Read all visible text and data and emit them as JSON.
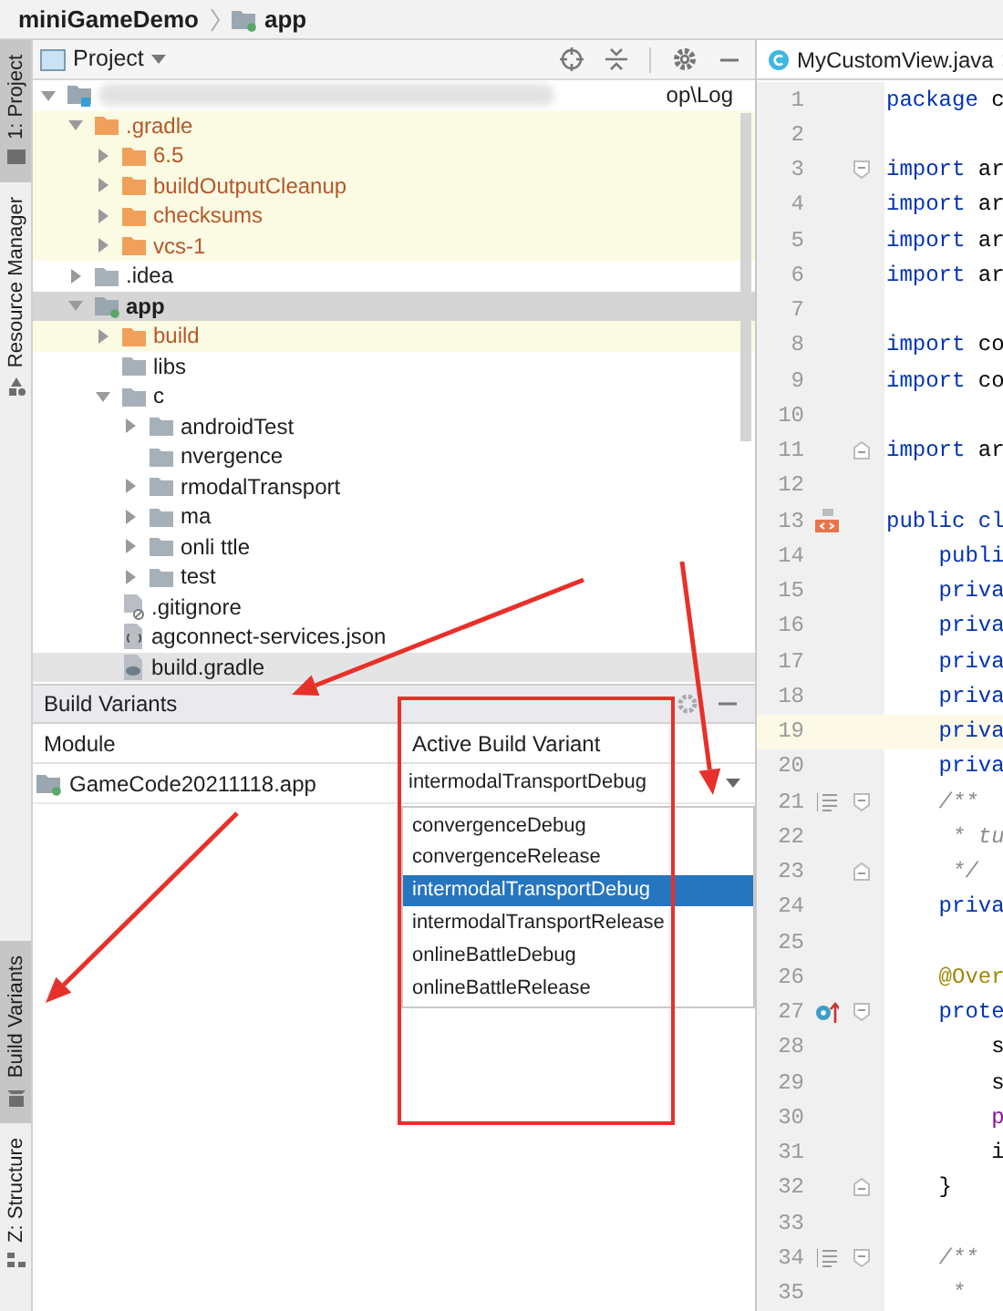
{
  "breadcrumb": [
    {
      "label": "miniGameDemo",
      "kind": "project"
    },
    {
      "label": "app",
      "kind": "module"
    }
  ],
  "tool_strip": {
    "top": [
      {
        "label": "1: Project",
        "kind": "folder",
        "selected": true
      },
      {
        "label": "Resource Manager",
        "kind": "resources",
        "selected": false
      }
    ],
    "bottom": [
      {
        "label": "Build Variants",
        "kind": "android",
        "selected": true
      },
      {
        "label": "Z: Structure",
        "kind": "structure",
        "selected": false
      }
    ]
  },
  "project_panel": {
    "title": "Project",
    "tree": [
      {
        "kind": "module-root",
        "label": "op\\Log",
        "expanded": true,
        "excluded": false,
        "selected": false,
        "children": [
          {
            "kind": "folder",
            "label": ".gradle",
            "expanded": true,
            "excluded": true,
            "selected": false,
            "children": [
              {
                "kind": "folder",
                "label": "6.5",
                "expanded": false,
                "excluded": true,
                "selected": false
              },
              {
                "kind": "folder",
                "label": "buildOutputCleanup",
                "expanded": false,
                "excluded": true,
                "selected": false
              },
              {
                "kind": "folder",
                "label": "checksums",
                "expanded": false,
                "excluded": true,
                "selected": false
              },
              {
                "kind": "folder",
                "label": "vcs-1",
                "expanded": false,
                "excluded": true,
                "selected": false
              }
            ]
          },
          {
            "kind": "folder",
            "label": ".idea",
            "expanded": false,
            "excluded": false,
            "selected": false
          },
          {
            "kind": "module",
            "label": "app",
            "expanded": true,
            "excluded": false,
            "selected": true,
            "children": [
              {
                "kind": "folder",
                "label": "build",
                "expanded": false,
                "excluded": true,
                "selected": false
              },
              {
                "kind": "folder",
                "label": "libs",
                "excluded": false,
                "selected": false
              },
              {
                "kind": "folder",
                "label": "c",
                "expanded": true,
                "excluded": false,
                "selected": false,
                "children": [
                  {
                    "kind": "folder",
                    "label": "androidTest",
                    "expanded": false,
                    "excluded": false,
                    "selected": false
                  },
                  {
                    "kind": "folder",
                    "label": "nvergence",
                    "excluded": false,
                    "selected": false
                  },
                  {
                    "kind": "folder",
                    "label": "rmodalTransport",
                    "expanded": false,
                    "excluded": false,
                    "selected": false
                  },
                  {
                    "kind": "folder",
                    "label": "ma",
                    "expanded": false,
                    "excluded": false,
                    "selected": false
                  },
                  {
                    "kind": "folder",
                    "label": "onli ttle",
                    "expanded": false,
                    "excluded": false,
                    "selected": false
                  },
                  {
                    "kind": "folder",
                    "label": "test",
                    "expanded": false,
                    "excluded": false,
                    "selected": false
                  }
                ]
              },
              {
                "kind": "file-ignore",
                "label": ".gitignore",
                "excluded": false,
                "selected": false
              },
              {
                "kind": "file-json",
                "label": "agconnect-services.json",
                "excluded": false,
                "selected": false
              },
              {
                "kind": "file-gradle",
                "label": "build.gradle",
                "excluded": false,
                "selected": true
              }
            ]
          }
        ]
      }
    ]
  },
  "build_variants": {
    "title": "Build Variants",
    "columns": [
      "Module",
      "Active Build Variant"
    ],
    "rows": [
      {
        "module": "GameCode20211118.app",
        "variant": "intermodalTransportDebug"
      }
    ],
    "options": [
      {
        "label": "convergenceDebug",
        "selected": false
      },
      {
        "label": "convergenceRelease",
        "selected": false
      },
      {
        "label": "intermodalTransportDebug",
        "selected": true
      },
      {
        "label": "intermodalTransportRelease",
        "selected": false
      },
      {
        "label": "onlineBattleDebug",
        "selected": false
      },
      {
        "label": "onlineBattleRelease",
        "selected": false
      }
    ]
  },
  "editor": {
    "tabs": [
      {
        "label": "MyCustomView.java",
        "selected": true
      }
    ],
    "lines": [
      {
        "number": "1",
        "current": false,
        "tokens": [
          {
            "text": "package",
            "kind": "keyword"
          },
          {
            "text": " c",
            "kind": "plain"
          }
        ]
      },
      {
        "number": "2",
        "current": false
      },
      {
        "number": "3",
        "current": false,
        "fold_start": true,
        "tokens": [
          {
            "text": "import",
            "kind": "keyword"
          },
          {
            "text": " ar",
            "kind": "plain"
          }
        ]
      },
      {
        "number": "4",
        "current": false,
        "tokens": [
          {
            "text": "import",
            "kind": "keyword"
          },
          {
            "text": " ar",
            "kind": "plain"
          }
        ]
      },
      {
        "number": "5",
        "current": false,
        "tokens": [
          {
            "text": "import",
            "kind": "keyword"
          },
          {
            "text": " ar",
            "kind": "plain"
          }
        ]
      },
      {
        "number": "6",
        "current": false,
        "tokens": [
          {
            "text": "import",
            "kind": "keyword"
          },
          {
            "text": " ar",
            "kind": "plain"
          }
        ]
      },
      {
        "number": "7",
        "current": false
      },
      {
        "number": "8",
        "current": false,
        "tokens": [
          {
            "text": "import",
            "kind": "keyword"
          },
          {
            "text": " co",
            "kind": "plain"
          }
        ]
      },
      {
        "number": "9",
        "current": false,
        "tokens": [
          {
            "text": "import",
            "kind": "keyword"
          },
          {
            "text": " co",
            "kind": "plain"
          }
        ]
      },
      {
        "number": "10",
        "current": false
      },
      {
        "number": "11",
        "current": false,
        "fold_end": true,
        "tokens": [
          {
            "text": "import",
            "kind": "keyword"
          },
          {
            "text": " ar",
            "kind": "plain"
          }
        ]
      },
      {
        "number": "12",
        "current": false
      },
      {
        "number": "13",
        "current": false,
        "class_marker": true,
        "tokens": [
          {
            "text": "public",
            "kind": "keyword"
          },
          {
            "text": " cl",
            "kind": "keyword"
          }
        ]
      },
      {
        "number": "14",
        "current": false,
        "tokens": [
          {
            "text": "    publi",
            "kind": "keyword"
          }
        ]
      },
      {
        "number": "15",
        "current": false,
        "tokens": [
          {
            "text": "    priva",
            "kind": "keyword"
          }
        ]
      },
      {
        "number": "16",
        "current": false,
        "tokens": [
          {
            "text": "    priva",
            "kind": "keyword"
          }
        ]
      },
      {
        "number": "17",
        "current": false,
        "tokens": [
          {
            "text": "    priva",
            "kind": "keyword"
          }
        ]
      },
      {
        "number": "18",
        "current": false,
        "tokens": [
          {
            "text": "    priva",
            "kind": "keyword"
          }
        ]
      },
      {
        "number": "19",
        "current": true,
        "tokens": [
          {
            "text": "    priva",
            "kind": "keyword"
          }
        ]
      },
      {
        "number": "20",
        "current": false,
        "tokens": [
          {
            "text": "    priva",
            "kind": "keyword"
          }
        ]
      },
      {
        "number": "21",
        "current": false,
        "doc_toggle": true,
        "fold_start": true,
        "tokens": [
          {
            "text": "    /**",
            "kind": "comment"
          }
        ]
      },
      {
        "number": "22",
        "current": false,
        "tokens": [
          {
            "text": "     * tu",
            "kind": "comment"
          }
        ]
      },
      {
        "number": "23",
        "current": false,
        "fold_end": true,
        "tokens": [
          {
            "text": "     */",
            "kind": "comment"
          }
        ]
      },
      {
        "number": "24",
        "current": false,
        "tokens": [
          {
            "text": "    priva",
            "kind": "keyword"
          }
        ]
      },
      {
        "number": "25",
        "current": false
      },
      {
        "number": "26",
        "current": false,
        "tokens": [
          {
            "text": "    @Over",
            "kind": "annotation"
          }
        ]
      },
      {
        "number": "27",
        "current": false,
        "overrides": true,
        "fold_start": true,
        "tokens": [
          {
            "text": "    prote",
            "kind": "keyword"
          }
        ]
      },
      {
        "number": "28",
        "current": false,
        "tokens": [
          {
            "text": "        s",
            "kind": "plain"
          }
        ]
      },
      {
        "number": "29",
        "current": false,
        "tokens": [
          {
            "text": "        s",
            "kind": "plain"
          }
        ]
      },
      {
        "number": "30",
        "current": false,
        "tokens": [
          {
            "text": "        p",
            "kind": "field"
          }
        ]
      },
      {
        "number": "31",
        "current": false,
        "tokens": [
          {
            "text": "        i",
            "kind": "plain"
          }
        ]
      },
      {
        "number": "32",
        "current": false,
        "fold_end": true,
        "tokens": [
          {
            "text": "    }",
            "kind": "plain"
          }
        ]
      },
      {
        "number": "33",
        "current": false
      },
      {
        "number": "34",
        "current": false,
        "doc_toggle": true,
        "fold_start": true,
        "tokens": [
          {
            "text": "    /**",
            "kind": "comment"
          }
        ]
      },
      {
        "number": "35",
        "current": false,
        "tokens": [
          {
            "text": "     *",
            "kind": "comment"
          }
        ]
      }
    ]
  },
  "annotations": [
    {
      "kind": "arrow"
    },
    {
      "kind": "arrow"
    },
    {
      "kind": "arrow"
    },
    {
      "kind": "box"
    }
  ]
}
